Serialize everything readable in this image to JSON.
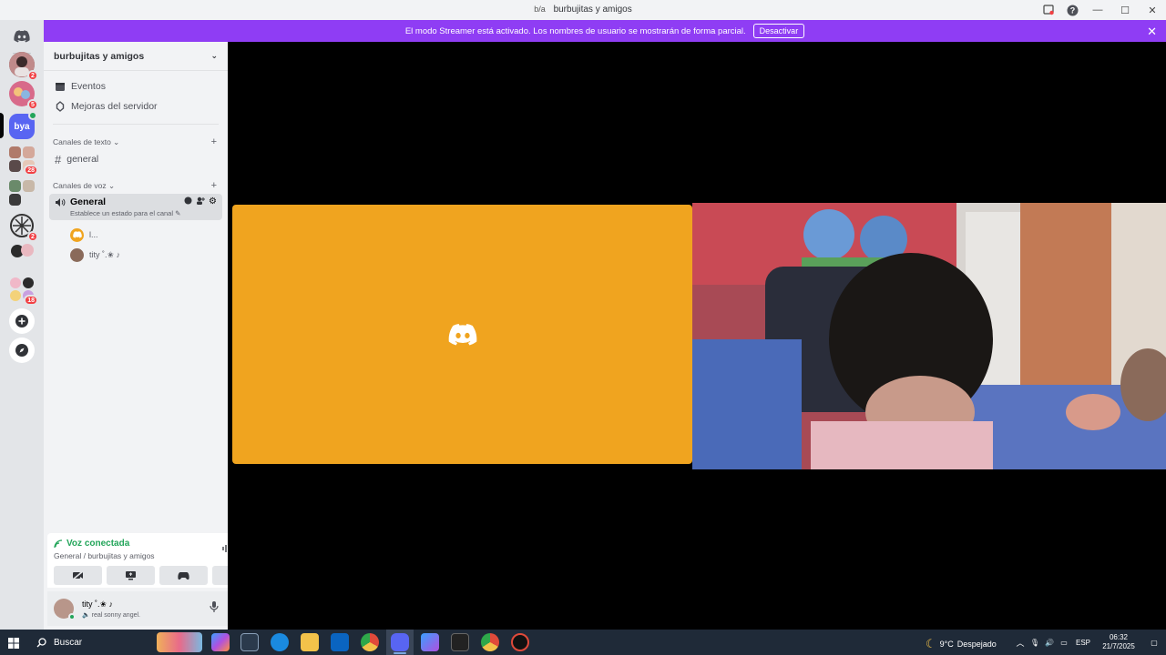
{
  "window": {
    "server_tag": "b/a",
    "title": "burbujitas y amigos"
  },
  "banner": {
    "text": "El modo Streamer está activado. Los nombres de usuario se mostrarán de forma parcial.",
    "button": "Desactivar",
    "color": "#8f3df4"
  },
  "guilds": [
    {
      "name": "guild-1",
      "badge": "2"
    },
    {
      "name": "guild-2",
      "badge": "5"
    },
    {
      "name": "guild-bya",
      "label": "bya",
      "selected": true
    },
    {
      "name": "guild-4",
      "badge": "28"
    },
    {
      "name": "guild-5",
      "badge": ""
    },
    {
      "name": "guild-6",
      "badge": "2"
    },
    {
      "name": "guild-7",
      "badge": ""
    },
    {
      "name": "guild-8",
      "badge": "18"
    }
  ],
  "sidebar": {
    "server_name": "burbujitas y amigos",
    "events": "Eventos",
    "boosts": "Mejoras del servidor",
    "text_category": "Canales de texto",
    "text_channel": "general",
    "voice_category": "Canales de voz",
    "voice_channel": "General",
    "voice_status": "Establece un estado para el canal",
    "voice_users": [
      {
        "name": "l..."
      },
      {
        "name": "tity ˚.✬ ♪"
      }
    ]
  },
  "voice_panel": {
    "title": "Voz conectada",
    "subtitle": "General / burbujitas y amigos"
  },
  "user": {
    "name": "tity ˚.✬ ♪",
    "status": "real sonny angel."
  },
  "taskbar": {
    "search": "Buscar",
    "weather_temp": "9°C",
    "weather_text": "Despejado",
    "lang": "ESP",
    "time": "06:32",
    "date": "21/7/2025"
  },
  "colors": {
    "orange_tile": "#f0a41f",
    "accent_green": "#23a55a",
    "badge_red": "#f23f43"
  }
}
